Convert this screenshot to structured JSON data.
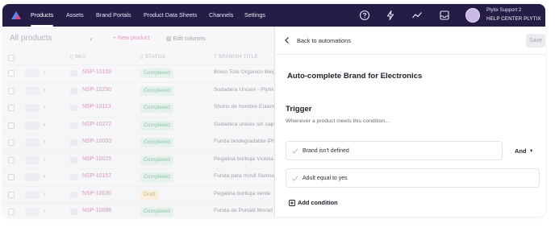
{
  "app": {
    "brand_color": "#261d47",
    "accent": "#d24a8c"
  },
  "nav": {
    "items": [
      {
        "label": "Products",
        "active": true
      },
      {
        "label": "Assets"
      },
      {
        "label": "Brand Portals"
      },
      {
        "label": "Product Data Sheets"
      },
      {
        "label": "Channels"
      },
      {
        "label": "Settings"
      }
    ],
    "icons": [
      "help-icon",
      "lightning-icon",
      "activity-icon",
      "inbox-icon"
    ],
    "user": {
      "name": "Plytix Support 2",
      "org": "HELP CENTER PLYTIX"
    }
  },
  "list": {
    "title": "All products",
    "new_label": "+ New product",
    "edit_columns_label": "Edit columns",
    "columns": {
      "sku": "SKU",
      "status": "STATUS",
      "title": "SPANISH TITLE"
    },
    "rows": [
      {
        "sku": "NSP-10109",
        "status": "Completed",
        "title": "Bolso Tote Orgánico Beig"
      },
      {
        "sku": "NSP-10250",
        "status": "Completed",
        "title": "Sudadera Unisex - Plytix"
      },
      {
        "sku": "NSP-10113",
        "status": "Completed",
        "title": "Shorts de hombre Estam"
      },
      {
        "sku": "NSP-10272",
        "status": "Completed",
        "title": "Sudadera unisex sin capu"
      },
      {
        "sku": "NSP-10003",
        "status": "Completed",
        "title": "Funda biodegradable iPh"
      },
      {
        "sku": "NSP-10025",
        "status": "Completed",
        "title": "Pegatina burbuja Violeta"
      },
      {
        "sku": "NSP-10157",
        "status": "Completed",
        "title": "Funda para móvil Samsu"
      },
      {
        "sku": "NSP-10030",
        "status": "Draft",
        "title": "Pegatina burbuja verde"
      },
      {
        "sku": "NSP-10086",
        "status": "Completed",
        "title": "Funda de Portátil Morad"
      }
    ]
  },
  "panel": {
    "back_label": "Back to automations",
    "save_label": "Save",
    "title": "Auto-complete Brand for Electronics",
    "trigger": {
      "heading": "Trigger",
      "subheading": "Whenever a product meets this condition...",
      "conditions": [
        {
          "text": "Brand isn't defined"
        },
        {
          "text": "Adult equal to yes"
        }
      ],
      "operator": "And",
      "add_label": "Add condition"
    }
  }
}
